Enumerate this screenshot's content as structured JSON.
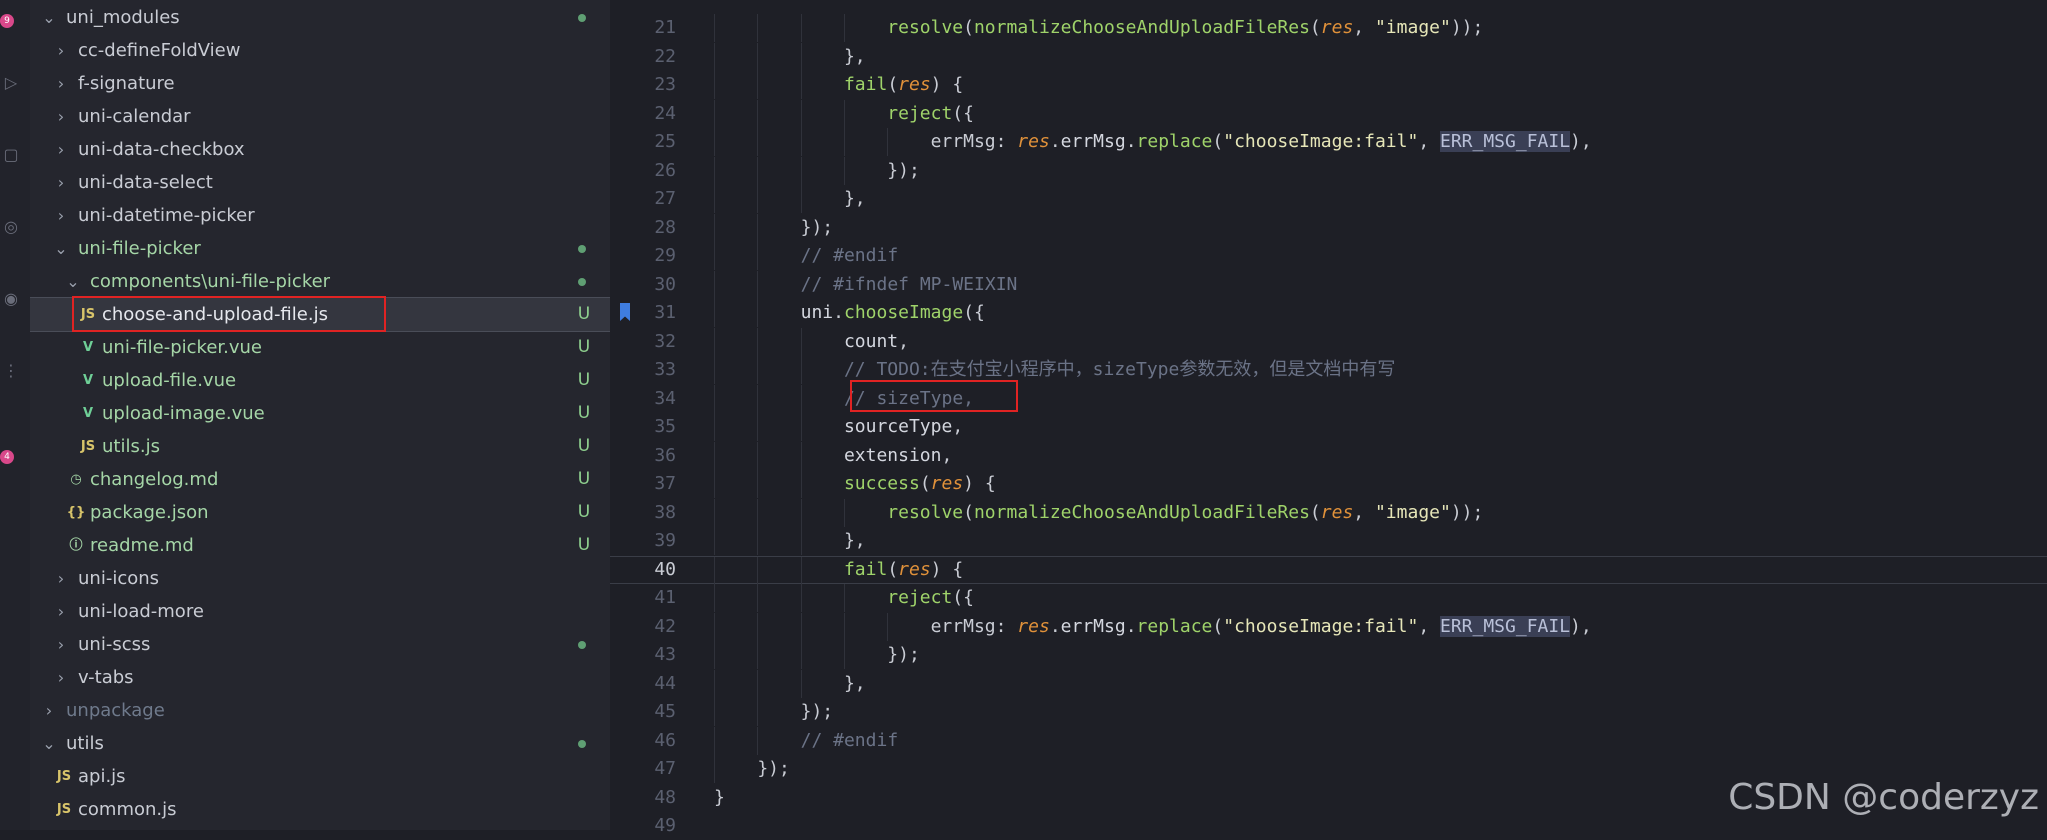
{
  "activity_bar": {
    "badges": [
      "9",
      "4"
    ],
    "icons": [
      "git-icon",
      "run-debug-icon",
      "extensions-icon",
      "remote-icon",
      "account-icon",
      "more-icon"
    ]
  },
  "explorer": {
    "items": [
      {
        "label": "uni_modules",
        "type": "folder-open",
        "depth": 1,
        "status": "dot"
      },
      {
        "label": "cc-defineFoldView",
        "type": "folder",
        "depth": 2
      },
      {
        "label": "f-signature",
        "type": "folder",
        "depth": 2
      },
      {
        "label": "uni-calendar",
        "type": "folder",
        "depth": 2
      },
      {
        "label": "uni-data-checkbox",
        "type": "folder",
        "depth": 2
      },
      {
        "label": "uni-data-select",
        "type": "folder",
        "depth": 2
      },
      {
        "label": "uni-datetime-picker",
        "type": "folder",
        "depth": 2
      },
      {
        "label": "uni-file-picker",
        "type": "folder-open",
        "depth": 2,
        "status": "dot",
        "green": true
      },
      {
        "label": "components\\uni-file-picker",
        "type": "folder-open",
        "depth": 3,
        "status": "dot",
        "green": true
      },
      {
        "label": "choose-and-upload-file.js",
        "type": "js",
        "depth": 4,
        "status": "U",
        "selected": true
      },
      {
        "label": "uni-file-picker.vue",
        "type": "vue",
        "depth": 4,
        "status": "U",
        "green": true
      },
      {
        "label": "upload-file.vue",
        "type": "vue",
        "depth": 4,
        "status": "U",
        "green": true
      },
      {
        "label": "upload-image.vue",
        "type": "vue",
        "depth": 4,
        "status": "U",
        "green": true
      },
      {
        "label": "utils.js",
        "type": "js",
        "depth": 4,
        "status": "U",
        "green": true
      },
      {
        "label": "changelog.md",
        "type": "md",
        "depth": 3,
        "status": "U",
        "green": true
      },
      {
        "label": "package.json",
        "type": "json",
        "depth": 3,
        "status": "U",
        "green": true
      },
      {
        "label": "readme.md",
        "type": "info",
        "depth": 3,
        "status": "U",
        "green": true
      },
      {
        "label": "uni-icons",
        "type": "folder",
        "depth": 2
      },
      {
        "label": "uni-load-more",
        "type": "folder",
        "depth": 2
      },
      {
        "label": "uni-scss",
        "type": "folder",
        "depth": 2,
        "status": "dot"
      },
      {
        "label": "v-tabs",
        "type": "folder",
        "depth": 2
      },
      {
        "label": "unpackage",
        "type": "folder",
        "depth": 1,
        "muted": true
      },
      {
        "label": "utils",
        "type": "folder-open",
        "depth": 1,
        "status": "dot"
      },
      {
        "label": "api.js",
        "type": "js",
        "depth": 2
      },
      {
        "label": "common.js",
        "type": "js",
        "depth": 2
      }
    ],
    "status_U": "U",
    "js_icon_text": "JS",
    "vue_icon_text": "V",
    "json_icon_text": "{}",
    "info_icon_text": "ⓘ",
    "md_icon_text": "◷"
  },
  "editor": {
    "current_line": "40",
    "lines": [
      {
        "n": "21",
        "indent": 4,
        "tokens": [
          [
            "fn",
            "resolve"
          ],
          [
            "punc",
            "("
          ],
          [
            "fn",
            "normalizeChooseAndUploadFileRes"
          ],
          [
            "punc",
            "("
          ],
          [
            "param",
            "res"
          ],
          [
            "punc",
            ", "
          ],
          [
            "str",
            "\"image\""
          ],
          [
            "punc",
            "));"
          ]
        ]
      },
      {
        "n": "22",
        "indent": 3,
        "tokens": [
          [
            "punc",
            "},"
          ]
        ]
      },
      {
        "n": "23",
        "indent": 3,
        "tokens": [
          [
            "fn",
            "fail"
          ],
          [
            "punc",
            "("
          ],
          [
            "param",
            "res"
          ],
          [
            "punc",
            ") {"
          ]
        ]
      },
      {
        "n": "24",
        "indent": 4,
        "tokens": [
          [
            "fn",
            "reject"
          ],
          [
            "punc",
            "({"
          ]
        ]
      },
      {
        "n": "25",
        "indent": 5,
        "tokens": [
          [
            "key",
            "errMsg: "
          ],
          [
            "param",
            "res"
          ],
          [
            "punc",
            "."
          ],
          [
            "id",
            "errMsg"
          ],
          [
            "punc",
            "."
          ],
          [
            "fn",
            "replace"
          ],
          [
            "punc",
            "("
          ],
          [
            "str",
            "\"chooseImage:fail\""
          ],
          [
            "punc",
            ", "
          ],
          [
            "macro",
            "ERR_MSG_FAIL"
          ],
          [
            "punc",
            "),"
          ]
        ]
      },
      {
        "n": "26",
        "indent": 4,
        "tokens": [
          [
            "punc",
            "});"
          ]
        ]
      },
      {
        "n": "27",
        "indent": 3,
        "tokens": [
          [
            "punc",
            "},"
          ]
        ]
      },
      {
        "n": "28",
        "indent": 2,
        "tokens": [
          [
            "punc",
            "});"
          ]
        ]
      },
      {
        "n": "29",
        "indent": 2,
        "tokens": [
          [
            "cm",
            "// #endif"
          ]
        ]
      },
      {
        "n": "30",
        "indent": 2,
        "tokens": [
          [
            "cm",
            "// #ifndef MP-WEIXIN"
          ]
        ]
      },
      {
        "n": "31",
        "indent": 2,
        "tokens": [
          [
            "id",
            "uni"
          ],
          [
            "punc",
            "."
          ],
          [
            "fn",
            "chooseImage"
          ],
          [
            "punc",
            "({"
          ]
        ]
      },
      {
        "n": "32",
        "indent": 3,
        "tokens": [
          [
            "id",
            "count"
          ],
          [
            "punc",
            ","
          ]
        ]
      },
      {
        "n": "33",
        "indent": 3,
        "tokens": [
          [
            "cm",
            "// TODO:在支付宝小程序中，sizeType参数无效，但是文档中有写"
          ]
        ]
      },
      {
        "n": "34",
        "indent": 3,
        "tokens": [
          [
            "cm",
            "// sizeType,"
          ]
        ]
      },
      {
        "n": "35",
        "indent": 3,
        "tokens": [
          [
            "id",
            "sourceType"
          ],
          [
            "punc",
            ","
          ]
        ]
      },
      {
        "n": "36",
        "indent": 3,
        "tokens": [
          [
            "id",
            "extension"
          ],
          [
            "punc",
            ","
          ]
        ]
      },
      {
        "n": "37",
        "indent": 3,
        "tokens": [
          [
            "fn",
            "success"
          ],
          [
            "punc",
            "("
          ],
          [
            "param",
            "res"
          ],
          [
            "punc",
            ") {"
          ]
        ]
      },
      {
        "n": "38",
        "indent": 4,
        "tokens": [
          [
            "fn",
            "resolve"
          ],
          [
            "punc",
            "("
          ],
          [
            "fn",
            "normalizeChooseAndUploadFileRes"
          ],
          [
            "punc",
            "("
          ],
          [
            "param",
            "res"
          ],
          [
            "punc",
            ", "
          ],
          [
            "str",
            "\"image\""
          ],
          [
            "punc",
            "));"
          ]
        ]
      },
      {
        "n": "39",
        "indent": 3,
        "tokens": [
          [
            "punc",
            "},"
          ]
        ]
      },
      {
        "n": "40",
        "indent": 3,
        "tokens": [
          [
            "fn",
            "fail"
          ],
          [
            "punc",
            "("
          ],
          [
            "param",
            "res"
          ],
          [
            "punc",
            ") {"
          ]
        ]
      },
      {
        "n": "41",
        "indent": 4,
        "tokens": [
          [
            "fn",
            "reject"
          ],
          [
            "punc",
            "({"
          ]
        ]
      },
      {
        "n": "42",
        "indent": 5,
        "tokens": [
          [
            "key",
            "errMsg: "
          ],
          [
            "param",
            "res"
          ],
          [
            "punc",
            "."
          ],
          [
            "id",
            "errMsg"
          ],
          [
            "punc",
            "."
          ],
          [
            "fn",
            "replace"
          ],
          [
            "punc",
            "("
          ],
          [
            "str",
            "\"chooseImage:fail\""
          ],
          [
            "punc",
            ", "
          ],
          [
            "macro",
            "ERR_MSG_FAIL"
          ],
          [
            "punc",
            "),"
          ]
        ]
      },
      {
        "n": "43",
        "indent": 4,
        "tokens": [
          [
            "punc",
            "});"
          ]
        ]
      },
      {
        "n": "44",
        "indent": 3,
        "tokens": [
          [
            "punc",
            "},"
          ]
        ]
      },
      {
        "n": "45",
        "indent": 2,
        "tokens": [
          [
            "punc",
            "});"
          ]
        ]
      },
      {
        "n": "46",
        "indent": 2,
        "tokens": [
          [
            "cm",
            "// #endif"
          ]
        ]
      },
      {
        "n": "47",
        "indent": 1,
        "tokens": [
          [
            "punc",
            "});"
          ]
        ]
      },
      {
        "n": "48",
        "indent": 0,
        "tokens": [
          [
            "punc",
            "}"
          ]
        ]
      },
      {
        "n": "49",
        "indent": 0,
        "tokens": []
      }
    ]
  },
  "watermark": "CSDN @coderzyz",
  "colors": {
    "highlight_box": "#e02323",
    "bookmark": "#3f7de0"
  }
}
